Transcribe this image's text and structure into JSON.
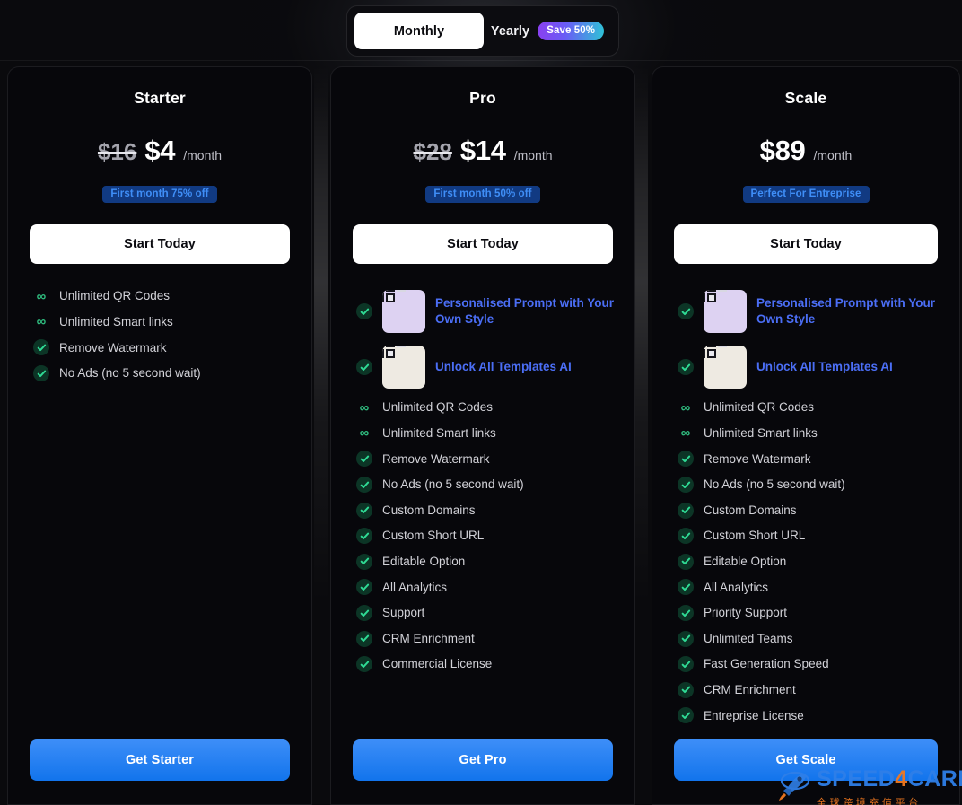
{
  "billing_toggle": {
    "monthly_label": "Monthly",
    "yearly_label": "Yearly",
    "save_badge": "Save 50%",
    "selected": "Monthly"
  },
  "colors": {
    "page_bg": "#0a0a0d",
    "card_bg": "#07070b",
    "accent_blue": "#1274ec",
    "badge_bg": "#113a82",
    "badge_text": "#3f8ef7",
    "check_green": "#2fbb7e",
    "highlight_text": "#4b6ef5",
    "save_gradient_from": "#8b3ff0",
    "save_gradient_to": "#2ec4d6",
    "watermark_blue": "#2f7fe8",
    "watermark_orange": "#f07820"
  },
  "plans": [
    {
      "name": "Starter",
      "price_old": "$16",
      "price_new": "$4",
      "price_period": "/month",
      "badge": "First month 75% off",
      "start_label": "Start Today",
      "cta_label": "Get Starter",
      "features": [
        {
          "icon": "infinity-icon",
          "text": "Unlimited QR Codes",
          "style": "normal"
        },
        {
          "icon": "infinity-icon",
          "text": "Unlimited Smart links",
          "style": "normal"
        },
        {
          "icon": "check-circle-icon",
          "text": "Remove Watermark",
          "style": "normal"
        },
        {
          "icon": "check-circle-icon",
          "text": "No Ads (no 5 second wait)",
          "style": "normal"
        }
      ]
    },
    {
      "name": "Pro",
      "price_old": "$28",
      "price_new": "$14",
      "price_period": "/month",
      "badge": "First month 50% off",
      "start_label": "Start Today",
      "cta_label": "Get Pro",
      "features": [
        {
          "icon": "check-circle-icon",
          "text": "Personalised Prompt with Your Own Style",
          "style": "highlight",
          "thumbnail": "qr-art-blue-figure"
        },
        {
          "icon": "check-circle-icon",
          "text": "Unlock All Templates AI",
          "style": "highlight",
          "thumbnail": "qr-art-landscape"
        },
        {
          "icon": "infinity-icon",
          "text": "Unlimited QR Codes",
          "style": "normal"
        },
        {
          "icon": "infinity-icon",
          "text": "Unlimited Smart links",
          "style": "normal"
        },
        {
          "icon": "check-circle-icon",
          "text": "Remove Watermark",
          "style": "normal"
        },
        {
          "icon": "check-circle-icon",
          "text": "No Ads (no 5 second wait)",
          "style": "normal"
        },
        {
          "icon": "check-circle-icon",
          "text": "Custom Domains",
          "style": "normal"
        },
        {
          "icon": "check-circle-icon",
          "text": "Custom Short URL",
          "style": "normal"
        },
        {
          "icon": "check-circle-icon",
          "text": "Editable Option",
          "style": "normal"
        },
        {
          "icon": "check-circle-icon",
          "text": "All Analytics",
          "style": "normal"
        },
        {
          "icon": "check-circle-icon",
          "text": "Support",
          "style": "normal"
        },
        {
          "icon": "check-circle-icon",
          "text": "CRM Enrichment",
          "style": "normal"
        },
        {
          "icon": "check-circle-icon",
          "text": "Commercial License",
          "style": "normal"
        }
      ]
    },
    {
      "name": "Scale",
      "price_old": "",
      "price_new": "$89",
      "price_period": "/month",
      "badge": "Perfect For Entreprise",
      "start_label": "Start Today",
      "cta_label": "Get Scale",
      "features": [
        {
          "icon": "check-circle-icon",
          "text": "Personalised Prompt with Your Own Style",
          "style": "highlight",
          "thumbnail": "qr-art-blue-figure"
        },
        {
          "icon": "check-circle-icon",
          "text": "Unlock All Templates AI",
          "style": "highlight",
          "thumbnail": "qr-art-landscape"
        },
        {
          "icon": "infinity-icon",
          "text": "Unlimited QR Codes",
          "style": "normal"
        },
        {
          "icon": "infinity-icon",
          "text": "Unlimited Smart links",
          "style": "normal"
        },
        {
          "icon": "check-circle-icon",
          "text": "Remove Watermark",
          "style": "normal"
        },
        {
          "icon": "check-circle-icon",
          "text": "No Ads (no 5 second wait)",
          "style": "normal"
        },
        {
          "icon": "check-circle-icon",
          "text": "Custom Domains",
          "style": "normal"
        },
        {
          "icon": "check-circle-icon",
          "text": "Custom Short URL",
          "style": "normal"
        },
        {
          "icon": "check-circle-icon",
          "text": "Editable Option",
          "style": "normal"
        },
        {
          "icon": "check-circle-icon",
          "text": "All Analytics",
          "style": "normal"
        },
        {
          "icon": "check-circle-icon",
          "text": "Priority Support",
          "style": "normal"
        },
        {
          "icon": "check-circle-icon",
          "text": "Unlimited Teams",
          "style": "normal"
        },
        {
          "icon": "check-circle-icon",
          "text": "Fast Generation Speed",
          "style": "normal"
        },
        {
          "icon": "check-circle-icon",
          "text": "CRM Enrichment",
          "style": "normal"
        },
        {
          "icon": "check-circle-icon",
          "text": "Entreprise License",
          "style": "normal"
        }
      ]
    }
  ],
  "watermark": {
    "brand_part1": "SPEED",
    "brand_part2": "4",
    "brand_part3": "CARD",
    "subtitle": "全球跨境充值平台",
    "icon": "rocket-icon"
  }
}
